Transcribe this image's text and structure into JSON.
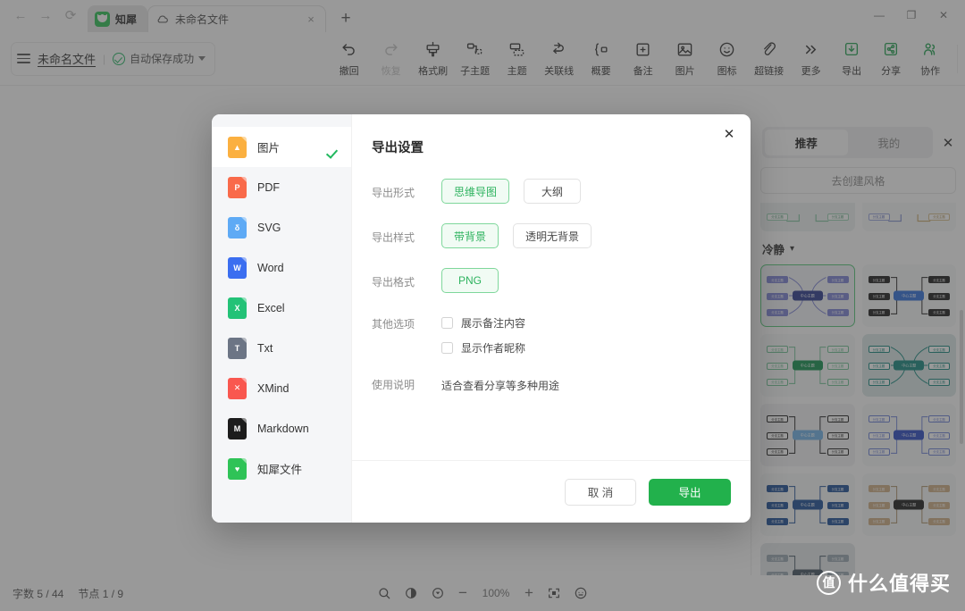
{
  "browser": {
    "nav": {
      "back": "←",
      "forward": "→",
      "reload": "⟳"
    },
    "extension_tab": {
      "label": "知犀",
      "icon": "zhixi-logo-icon"
    },
    "page_tab": {
      "title": "未命名文件",
      "favicon": "cloud-icon",
      "close": "×"
    },
    "new_tab": "+",
    "window_controls": {
      "minimize": "—",
      "maximize": "❐",
      "close": "✕"
    }
  },
  "app": {
    "doc_header": {
      "menu_icon": "hamburger-icon",
      "doc_name": "未命名文件",
      "separator": "|",
      "save_status": "自动保存成功",
      "dropdown": "▾"
    },
    "toolbar": [
      {
        "label": "撤回",
        "icon": "undo-icon",
        "disabled": false
      },
      {
        "label": "恢复",
        "icon": "redo-icon",
        "disabled": true
      },
      {
        "label": "格式刷",
        "icon": "format-painter-icon",
        "disabled": false
      },
      {
        "label": "子主题",
        "icon": "subtopic-icon",
        "disabled": false
      },
      {
        "label": "主题",
        "icon": "topic-icon",
        "disabled": false
      },
      {
        "label": "关联线",
        "icon": "relation-line-icon",
        "disabled": false
      },
      {
        "label": "概要",
        "icon": "summary-icon",
        "disabled": false
      },
      {
        "label": "备注",
        "icon": "note-icon",
        "disabled": false
      },
      {
        "label": "图片",
        "icon": "image-icon",
        "disabled": false
      },
      {
        "label": "图标",
        "icon": "emoji-icon",
        "disabled": false
      },
      {
        "label": "超链接",
        "icon": "hyperlink-icon",
        "disabled": false
      },
      {
        "label": "更多",
        "icon": "more-chevrons-icon",
        "disabled": false
      }
    ],
    "toolbar_right": [
      {
        "label": "导出",
        "icon": "download-icon"
      },
      {
        "label": "分享",
        "icon": "share-icon"
      },
      {
        "label": "协作",
        "icon": "collaborate-icon"
      }
    ],
    "avatar": "user-avatar"
  },
  "status_bar": {
    "word_count": "字数 5 / 44",
    "node_count": "节点 1 / 9",
    "zoom": {
      "search_icon": "search-icon",
      "pointer_icon": "pointer-mode-icon",
      "target_icon": "locate-icon",
      "minus": "−",
      "value": "100%",
      "plus": "+",
      "fit_icon": "fit-screen-icon",
      "help_icon": "help-icon"
    }
  },
  "template_panel": {
    "tabs": [
      {
        "label": "推荐",
        "active": true
      },
      {
        "label": "我的",
        "active": false
      }
    ],
    "close": "✕",
    "create_style_button": "去创建风格",
    "group_title": "冷静",
    "group_caret": "▾",
    "node_labels": {
      "center": "中心主题",
      "branch": "分支主题"
    },
    "cards": [
      {
        "style": "cool-purple",
        "selected": true,
        "bg": "#f3f4f8",
        "center": "#2b3a8f",
        "branch": "#7b82d6",
        "line": "#7b82d6",
        "curve": true
      },
      {
        "style": "black-blue",
        "selected": false,
        "bg": "#f7f8f9",
        "center": "#2f6fdc",
        "branch": "#1c1c1c",
        "line": "#1c1c1c",
        "curve": false
      },
      {
        "style": "green-light",
        "selected": false,
        "bg": "#f7f8f9",
        "center": "#11914f",
        "branch": "#ffffff",
        "line": "#6fc294",
        "curve": false
      },
      {
        "style": "teal-curve",
        "selected": false,
        "bg": "#dbe9e8",
        "center": "#15897f",
        "branch": "#ffffff",
        "line": "#15897f",
        "curve": true
      },
      {
        "style": "sky-black",
        "selected": false,
        "bg": "#f2f3f5",
        "center": "#6fb2e8",
        "branch": "#ffffff",
        "line": "#1c1c1c",
        "curve": false
      },
      {
        "style": "blue-outline",
        "selected": false,
        "bg": "#f7f8f9",
        "center": "#2b49c4",
        "branch": "#ffffff",
        "line": "#6a7fd8",
        "curve": false
      },
      {
        "style": "navy-solid",
        "selected": false,
        "bg": "#f7f8f9",
        "center": "#1d4e96",
        "branch": "#1d4e96",
        "line": "#1d4e96",
        "curve": false
      },
      {
        "style": "tan-black",
        "selected": false,
        "bg": "#f7f8f9",
        "center": "#1c1c1c",
        "branch": "#cfae84",
        "line": "#a88a62",
        "curve": false
      },
      {
        "style": "slate-gray",
        "selected": false,
        "bg": "#e4e8ea",
        "center": "#445563",
        "branch": "#9aa8b2",
        "line": "#445563",
        "curve": false
      }
    ]
  },
  "export_dialog": {
    "close": "✕",
    "title": "导出设置",
    "formats": [
      {
        "label": "图片",
        "icon_letter": "▲",
        "color": "#fbb040",
        "active": true,
        "checked": true
      },
      {
        "label": "PDF",
        "icon_letter": "P",
        "color": "#f96a4a",
        "active": false,
        "checked": false
      },
      {
        "label": "SVG",
        "icon_letter": "δ",
        "color": "#5eaaf5",
        "active": false,
        "checked": false
      },
      {
        "label": "Word",
        "icon_letter": "W",
        "color": "#3b6ef0",
        "active": false,
        "checked": false
      },
      {
        "label": "Excel",
        "icon_letter": "X",
        "color": "#23c277",
        "active": false,
        "checked": false
      },
      {
        "label": "Txt",
        "icon_letter": "T",
        "color": "#6c7585",
        "active": false,
        "checked": false
      },
      {
        "label": "XMind",
        "icon_letter": "✕",
        "color": "#f9574f",
        "active": false,
        "checked": false
      },
      {
        "label": "Markdown",
        "icon_letter": "M",
        "color": "#1c1c1c",
        "active": false,
        "checked": false
      },
      {
        "label": "知犀文件",
        "icon_letter": "♥",
        "color": "#2fc357",
        "active": false,
        "checked": false
      }
    ],
    "rows": {
      "form": {
        "label": "导出形式",
        "options": [
          {
            "text": "思维导图",
            "selected": true
          },
          {
            "text": "大纲",
            "selected": false
          }
        ]
      },
      "style": {
        "label": "导出样式",
        "options": [
          {
            "text": "带背景",
            "selected": true
          },
          {
            "text": "透明无背景",
            "selected": false
          }
        ]
      },
      "format": {
        "label": "导出格式",
        "options": [
          {
            "text": "PNG",
            "selected": true
          }
        ]
      },
      "other": {
        "label": "其他选项",
        "checkboxes": [
          {
            "text": "展示备注内容",
            "checked": false
          },
          {
            "text": "显示作者昵称",
            "checked": false
          }
        ]
      },
      "usage": {
        "label": "使用说明",
        "text": "适合查看分享等多种用途"
      }
    },
    "footer": {
      "cancel": "取 消",
      "confirm": "导出"
    }
  },
  "watermark": {
    "logo": "值",
    "text": "什么值得买"
  },
  "colors": {
    "brand_green": "#22b14c",
    "accent_green": "#2eb35f",
    "overlay": "#3c3c3c"
  }
}
